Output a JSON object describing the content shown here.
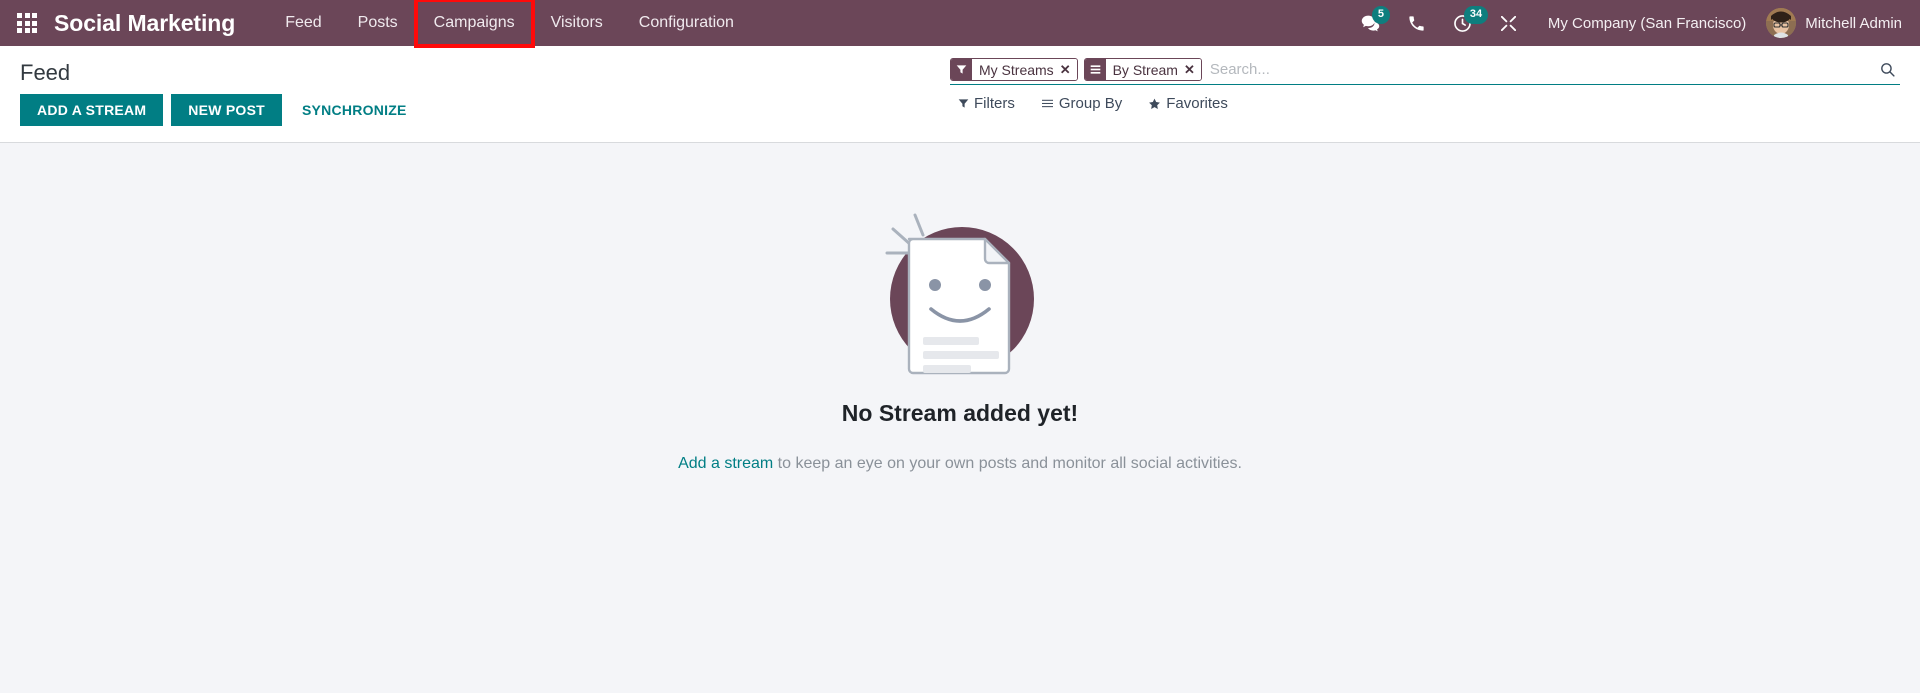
{
  "navbar": {
    "apps_icon": "apps-grid-icon",
    "brand": "Social Marketing",
    "menu": [
      {
        "label": "Feed",
        "highlighted": false
      },
      {
        "label": "Posts",
        "highlighted": false
      },
      {
        "label": "Campaigns",
        "highlighted": true
      },
      {
        "label": "Visitors",
        "highlighted": false
      },
      {
        "label": "Configuration",
        "highlighted": false
      }
    ],
    "systray": [
      {
        "icon": "messages-icon",
        "badge": "5"
      },
      {
        "icon": "phone-icon",
        "badge": ""
      },
      {
        "icon": "clock-activity-icon",
        "badge": "34"
      },
      {
        "icon": "tools-icon",
        "badge": ""
      }
    ],
    "company": "My Company (San Francisco)",
    "avatar_icon": "user-avatar",
    "username": "Mitchell Admin"
  },
  "control_panel": {
    "breadcrumb": "Feed",
    "buttons": [
      {
        "label": "ADD A STREAM",
        "style": "primary"
      },
      {
        "label": "NEW POST",
        "style": "primary"
      },
      {
        "label": "SYNCHRONIZE",
        "style": "link"
      }
    ],
    "search": {
      "placeholder": "Search...",
      "value": "",
      "search_icon": "search-icon",
      "facets": [
        {
          "icon": "filter-icon",
          "label": "My Streams",
          "close": "✕"
        },
        {
          "icon": "group-by-icon",
          "label": "By Stream",
          "close": "✕"
        }
      ]
    },
    "dropdowns": [
      {
        "icon": "filter-icon",
        "label": "Filters"
      },
      {
        "icon": "group-by-icon",
        "label": "Group By"
      },
      {
        "icon": "star-icon",
        "label": "Favorites"
      }
    ]
  },
  "content": {
    "empty_state": {
      "illustration": "no-content-document-smiley-icon",
      "title": "No Stream added yet!",
      "link_text": "Add a stream",
      "description": " to keep an eye on your own posts and monitor all social activities."
    }
  },
  "colors": {
    "navbar_bg": "#6B4658",
    "primary_teal": "#017E84",
    "badge_teal": "#0E7E7E",
    "body_bg": "#F4F5F8",
    "highlight_red": "#FF0A0A",
    "illustration_plum": "#6B4658"
  }
}
